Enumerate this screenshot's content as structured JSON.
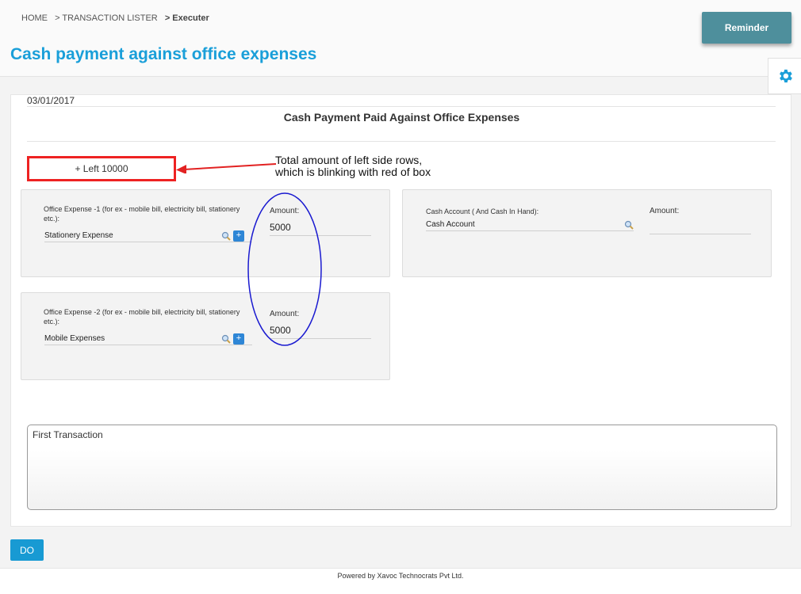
{
  "breadcrumb": {
    "home": "HOME",
    "lister": "> TRANSACTION LISTER",
    "current": "> Executer"
  },
  "page_title": "Cash payment against office expenses",
  "reminder_label": "Reminder",
  "voucher": {
    "date": "03/01/2017",
    "title": "Cash Payment Paid Against Office Expenses",
    "left_total": "+ Left 10000"
  },
  "annotation": {
    "line1": "Total amount of left side rows,",
    "line2": "which is blinking with red of box"
  },
  "left_rows": [
    {
      "label_line1": "Office Expense -1 (for ex - mobile bill, electricity bill, stationery",
      "label_line2": "etc.):",
      "account": "Stationery Expense",
      "amount_label": "Amount:",
      "amount": "5000"
    },
    {
      "label_line1": "Office Expense -2 (for ex - mobile bill, electricity bill, stationery",
      "label_line2": "etc.):",
      "account": "Mobile Expenses",
      "amount_label": "Amount:",
      "amount": "5000"
    }
  ],
  "right_row": {
    "label": "Cash Account ( And Cash In Hand):",
    "account": "Cash Account",
    "amount_label": "Amount:",
    "amount": ""
  },
  "narration": "First Transaction",
  "do_label": "DO",
  "footer": "Powered by Xavoc Technocrats Pvt Ltd.",
  "colors": {
    "title_blue": "#1a9fd9",
    "reminder_teal": "#4e8f9c",
    "highlight_red": "#e22222",
    "ellipse_blue": "#1a1ad0",
    "do_blue": "#189ad3"
  },
  "icons": [
    "gear-icon",
    "search-icon",
    "plus-icon",
    "arrow-icon"
  ]
}
